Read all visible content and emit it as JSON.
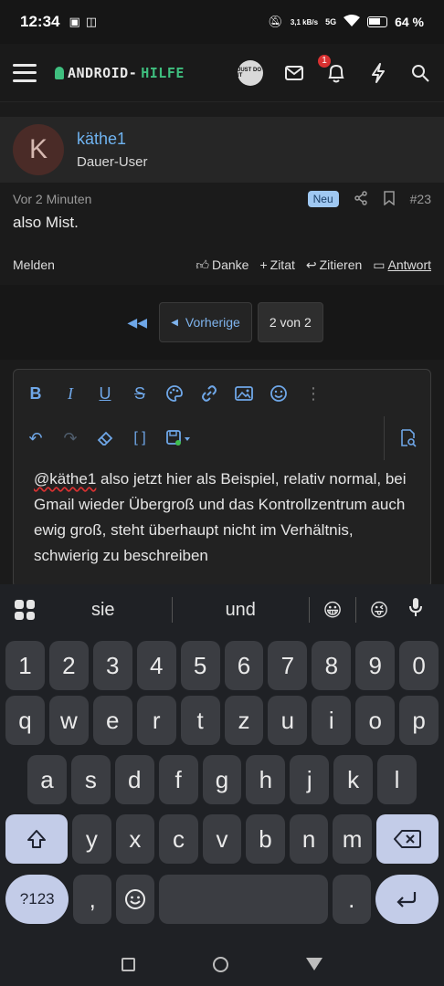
{
  "status_bar": {
    "time": "12:34",
    "net_speed": "3,1 kB/s",
    "network": "5G",
    "battery": "64 %"
  },
  "header": {
    "logo_left": "ANDROID-",
    "logo_right": "HILFE",
    "badge_count": "1",
    "nike_label": "JUST DO IT"
  },
  "post": {
    "avatar_letter": "K",
    "username": "käthe1",
    "user_title": "Dauer-User",
    "time_ago": "Vor 2 Minuten",
    "new_badge": "Neu",
    "post_number": "#23",
    "text": "also Mist.",
    "report": "Melden",
    "thanks": "Danke",
    "quote_add": "Zitat",
    "quote": "Zitieren",
    "reply": "Antwort"
  },
  "pagination": {
    "prev": "Vorherige",
    "current": "2 von 2"
  },
  "editor": {
    "mention": "@käthe1",
    "text": " also jetzt hier als Beispiel, relativ normal, bei Gmail wieder Übergroß und das Kontrollzentrum auch ewig groß, steht überhaupt nicht im Verhältnis, schwierig zu beschreiben"
  },
  "keyboard": {
    "suggestions": [
      "sie",
      "und"
    ],
    "emoji_1": "😀",
    "emoji_2": "😜",
    "row_numbers": [
      "1",
      "2",
      "3",
      "4",
      "5",
      "6",
      "7",
      "8",
      "9",
      "0"
    ],
    "row_1": [
      "q",
      "w",
      "e",
      "r",
      "t",
      "z",
      "u",
      "i",
      "o",
      "p"
    ],
    "row_2": [
      "a",
      "s",
      "d",
      "f",
      "g",
      "h",
      "j",
      "k",
      "l"
    ],
    "row_3": [
      "y",
      "x",
      "c",
      "v",
      "b",
      "n",
      "m"
    ],
    "symbols": "?123",
    "comma": ",",
    "period": "."
  }
}
